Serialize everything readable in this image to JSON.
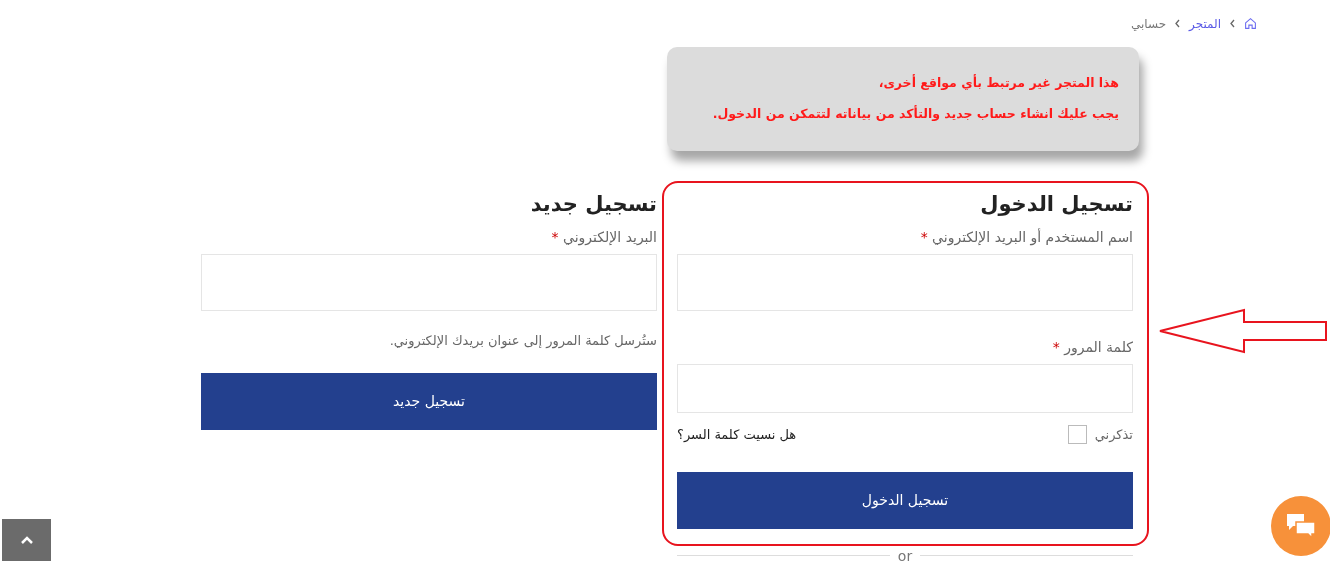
{
  "breadcrumb": [
    {
      "label": "المتجر",
      "kind": "link"
    },
    {
      "label": "حسابي",
      "kind": "current"
    }
  ],
  "notice": {
    "lines": [
      "هذا المتجر غير مرتبط بأي مواقع أخرى،",
      "يجب عليك انشاء حساب جديد والتأكد من بياناته لتتمكن من الدخول."
    ]
  },
  "login": {
    "title": "تسجيل الدخول",
    "fields": [
      {
        "label": "اسم المستخدم أو البريد الإلكتروني",
        "required_mark": "*"
      },
      {
        "label": "كلمة المرور",
        "required_mark": "*"
      }
    ],
    "remember": {
      "label": "تذكرني",
      "checked": false
    },
    "forgot_link": "هل نسيت كلمة السر؟",
    "submit": "تسجيل الدخول",
    "divider": "or"
  },
  "register": {
    "title": "تسجيل جديد",
    "fields": [
      {
        "label": "البريد الإلكتروني",
        "required_mark": "*"
      }
    ],
    "note": "ستُرسل كلمة المرور إلى عنوان بريدك الإلكتروني.",
    "submit": "تسجيل جديد"
  }
}
